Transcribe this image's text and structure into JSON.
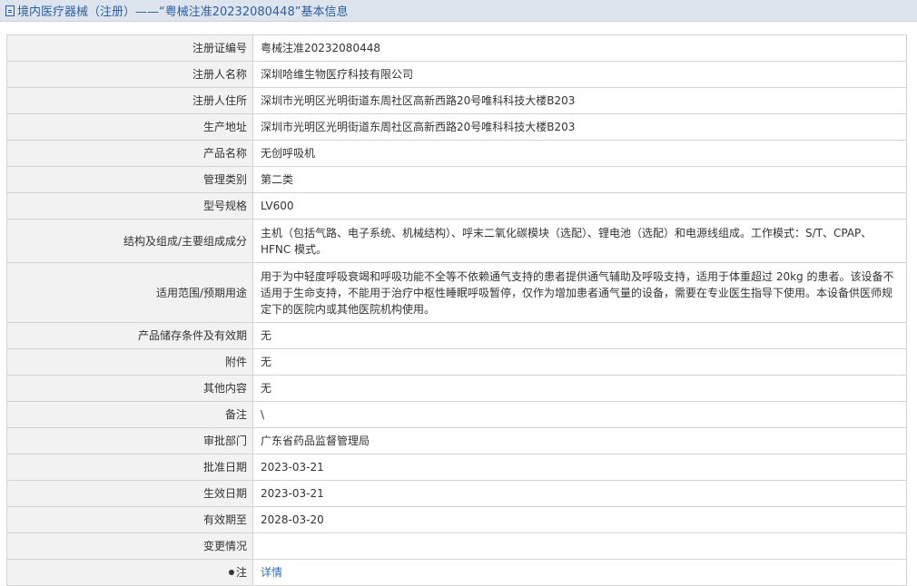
{
  "header": {
    "title": "境内医疗器械（注册）——“粤械注准20232080448”基本信息"
  },
  "rows": [
    {
      "label": "注册证编号",
      "value": "粤械注准20232080448"
    },
    {
      "label": "注册人名称",
      "value": "深圳哈维生物医疗科技有限公司"
    },
    {
      "label": "注册人住所",
      "value": "深圳市光明区光明街道东周社区高新西路20号唯科科技大楼B203"
    },
    {
      "label": "生产地址",
      "value": "深圳市光明区光明街道东周社区高新西路20号唯科科技大楼B203"
    },
    {
      "label": "产品名称",
      "value": "无创呼吸机"
    },
    {
      "label": "管理类别",
      "value": "第二类"
    },
    {
      "label": "型号规格",
      "value": "LV600"
    },
    {
      "label": "结构及组成/主要组成成分",
      "value": "主机（包括气路、电子系统、机械结构）、呼末二氧化碳模块（选配）、锂电池（选配）和电源线组成。工作模式：S/T、CPAP、HFNC 模式。"
    },
    {
      "label": "适用范围/预期用途",
      "value": "用于为中轻度呼吸衰竭和呼吸功能不全等不依赖通气支持的患者提供通气辅助及呼吸支持，适用于体重超过 20kg 的患者。该设备不适用于生命支持，不能用于治疗中枢性睡眠呼吸暂停，仅作为增加患者通气量的设备，需要在专业医生指导下使用。本设备供医师规定下的医院内或其他医院机构使用。"
    },
    {
      "label": "产品储存条件及有效期",
      "value": "无"
    },
    {
      "label": "附件",
      "value": "无"
    },
    {
      "label": "其他内容",
      "value": "无"
    },
    {
      "label": "备注",
      "value": "\\"
    },
    {
      "label": "审批部门",
      "value": "广东省药品监督管理局"
    },
    {
      "label": "批准日期",
      "value": "2023-03-21"
    },
    {
      "label": "生效日期",
      "value": "2023-03-21"
    },
    {
      "label": "有效期至",
      "value": "2028-03-20"
    },
    {
      "label": "变更情况",
      "value": ""
    }
  ],
  "note_row": {
    "label": "注",
    "icon": "pin-icon",
    "link": "详情"
  }
}
